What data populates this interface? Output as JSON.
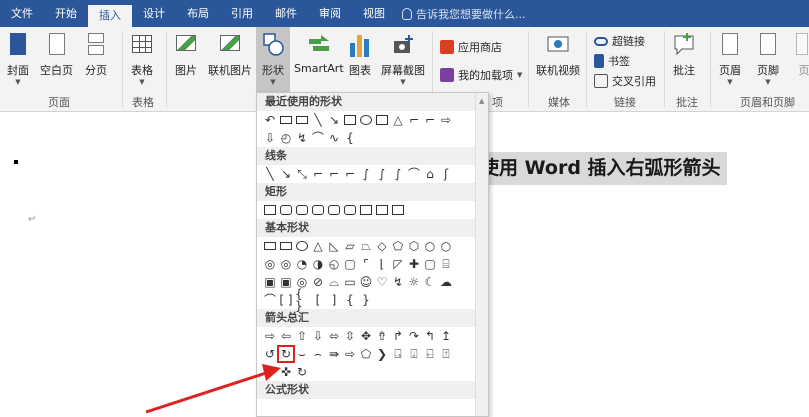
{
  "tabs": [
    "文件",
    "开始",
    "插入",
    "设计",
    "布局",
    "引用",
    "邮件",
    "审阅",
    "视图"
  ],
  "active_tab": "插入",
  "tell_me": "告诉我您想要做什么...",
  "ribbon": {
    "cover": "封面",
    "blank": "空白页",
    "break": "分页",
    "group_pages": "页面",
    "table": "表格",
    "group_table": "表格",
    "picture": "图片",
    "online_picture": "联机图片",
    "shapes": "形状",
    "smartart": "SmartArt",
    "chart": "图表",
    "screenshot": "屏幕截图",
    "store": "应用商店",
    "my_addins": "我的加载项",
    "group_addins": "项",
    "online_video": "联机视频",
    "group_media": "媒体",
    "hyperlink": "超链接",
    "bookmark": "书签",
    "crossref": "交叉引用",
    "group_links": "链接",
    "comment": "批注",
    "group_comment": "批注",
    "header": "页眉",
    "footer": "页脚",
    "page_num": "页",
    "group_hf": "页眉和页脚"
  },
  "shapes_menu": {
    "recent": "最近使用的形状",
    "lines": "线条",
    "rect": "矩形",
    "basic": "基本形状",
    "arrows": "箭头总汇",
    "formula": "公式形状"
  },
  "document": {
    "heading": "使用 Word 插入右弧形箭头"
  },
  "colors": {
    "accent": "#2b579a",
    "highlight": "#e02020"
  }
}
